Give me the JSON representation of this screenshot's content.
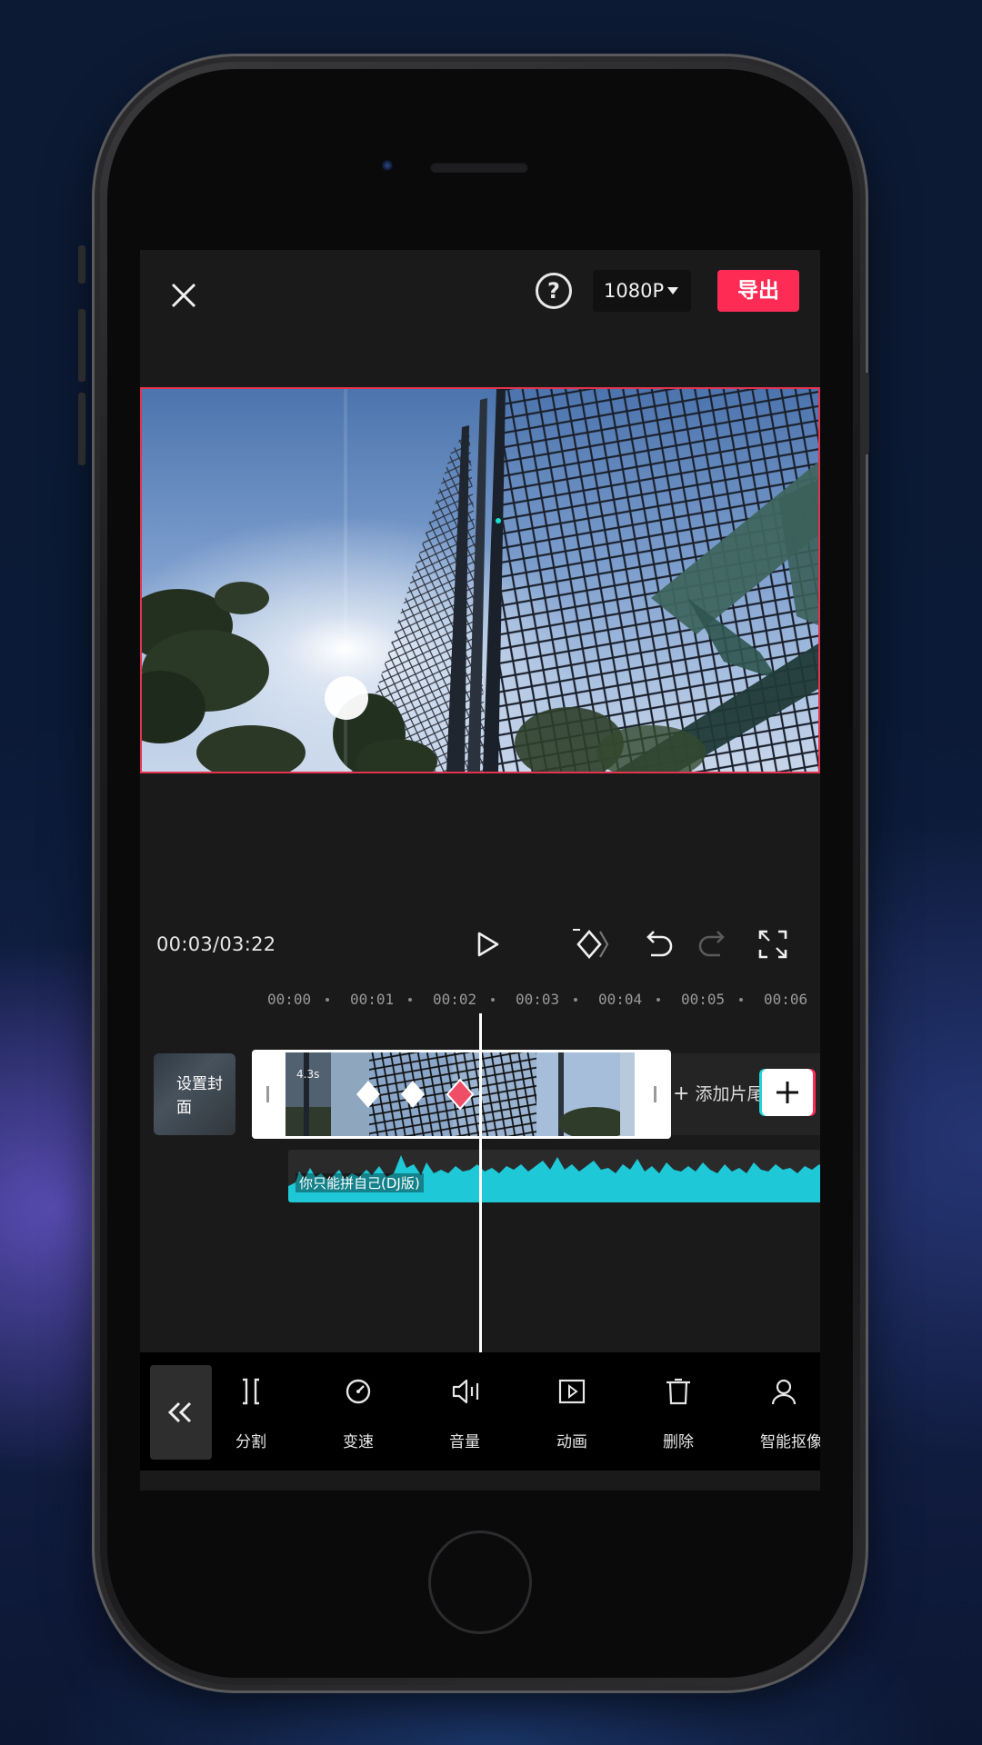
{
  "top_bar": {
    "resolution": "1080P",
    "export_label": "导出",
    "help_glyph": "?"
  },
  "player": {
    "timecode": "00:03/03:22"
  },
  "ruler": {
    "ticks": [
      "00:00",
      "00:01",
      "00:02",
      "00:03",
      "00:04",
      "00:05",
      "00:06"
    ]
  },
  "tracks": {
    "cover_label": "设置封面",
    "clip_duration": "4.3s",
    "add_tail_label": "添加片尾",
    "audio_title": "你只能拼自己(DJ版)"
  },
  "toolbar": {
    "items": [
      {
        "label": "分割",
        "icon": "split-icon"
      },
      {
        "label": "变速",
        "icon": "speed-icon"
      },
      {
        "label": "音量",
        "icon": "volume-icon"
      },
      {
        "label": "动画",
        "icon": "animation-icon"
      },
      {
        "label": "删除",
        "icon": "delete-icon"
      },
      {
        "label": "智能抠像",
        "icon": "smart-cutout-icon"
      }
    ]
  },
  "colors": {
    "accent": "#fe2c55",
    "audio_wave": "#1ec8d6",
    "selection_border": "#e3334e"
  }
}
